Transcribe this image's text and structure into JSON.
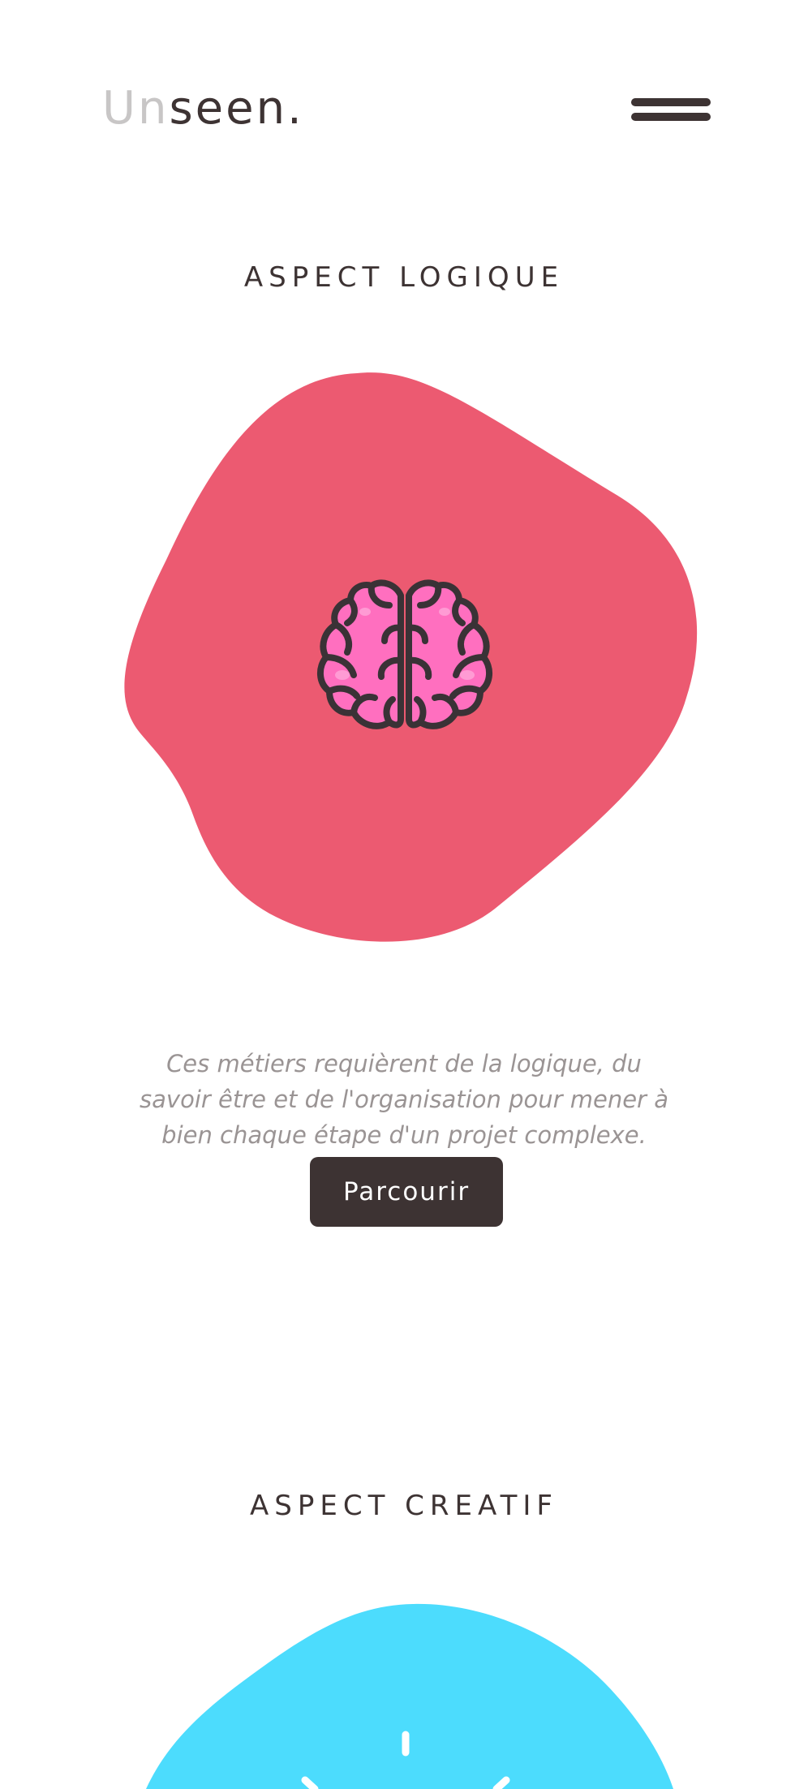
{
  "header": {
    "logo": {
      "light": "Un",
      "dark": "seen."
    },
    "menu_icon": "hamburger-icon"
  },
  "sections": [
    {
      "title": "ASPECT LOGIQUE",
      "blob_color": "#ec5a71",
      "icon": "brain-icon",
      "description": "Ces métiers requièrent de la logique, du savoir être et de l'organisation pour mener à bien chaque étape d'un projet complexe.",
      "button_label": "Parcourir"
    },
    {
      "title": "ASPECT CREATIF",
      "blob_color": "#4cdcfd",
      "icon": "lightbulb-icon"
    }
  ],
  "colors": {
    "text_dark": "#3d3333",
    "text_muted": "#9a9494",
    "brain_pink": "#ff6fbf",
    "brain_outline": "#3a3236"
  }
}
